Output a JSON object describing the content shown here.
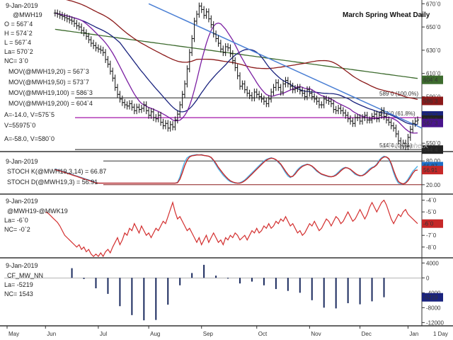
{
  "chart_data": [
    {
      "type": "candlestick",
      "title": "March Spring Wheat Daily",
      "header": {
        "date": "9-Jan-2019",
        "symbol": "@MWH19",
        "open": "O = 567`4",
        "high": "H = 574`2",
        "low": "L = 567`4",
        "last": "La= 570`2",
        "net_change": "NC= 3`0",
        "ma_20": "MOV(@MWH19,20) = 567`3",
        "ma_50": "MOV(@MWH19,50) = 573`7",
        "ma_100": "MOV(@MWH19,100) = 586`3",
        "ma_200": "MOV(@MWH19,200) = 604`4",
        "a_line": "A=-14.0, V=575`5",
        "volume": "V=55975`0",
        "a_line2": "A=-58.0, V=580`0"
      },
      "ylim": [
        544,
        672
      ],
      "y_ticks": [
        "670`0",
        "650`0",
        "630`0",
        "610`0",
        "590`0",
        "570`0",
        "550`0"
      ],
      "y_tick_values": [
        670,
        650,
        630,
        610,
        590,
        570,
        550
      ],
      "right_badges": [
        {
          "text": "604`4",
          "value": 604.5,
          "color": "#3d6b2e"
        },
        {
          "text": "586`3",
          "value": 586.4,
          "color": "#8b1a1a"
        },
        {
          "text": "573`7",
          "value": 573.9,
          "color": "#1a237e"
        },
        {
          "text": "570`2",
          "value": 570.25,
          "color": "#222222"
        },
        {
          "text": "567`3",
          "value": 567.4,
          "color": "#4a148c"
        },
        {
          "text": "544`4",
          "value": 544.5,
          "color": "#222222"
        }
      ],
      "fib_labels": [
        {
          "text": "589`0 (100.0%)",
          "value": 589.0
        },
        {
          "text": "572`0 (61.8%)",
          "value": 572.0
        },
        {
          "text": "544`4 (0.0%)",
          "value": 544.5
        }
      ],
      "watermark": "DTN ProphetX",
      "closes": [
        662,
        661,
        660,
        659,
        658,
        657,
        656,
        655,
        653,
        651,
        650,
        647,
        645,
        642,
        639,
        636,
        634,
        632,
        631,
        630,
        628,
        622,
        618,
        612,
        606,
        598,
        592,
        588,
        585,
        583,
        582,
        584,
        581,
        578,
        581,
        579,
        580,
        583,
        578,
        574,
        577,
        572,
        571,
        574,
        568,
        565,
        567,
        563,
        566,
        564,
        570,
        575,
        583,
        592,
        601,
        614,
        628,
        640,
        655,
        661,
        668,
        665,
        660,
        663,
        657,
        652,
        644,
        640,
        636,
        631,
        628,
        633,
        632,
        627,
        621,
        615,
        608,
        599,
        601,
        596,
        593,
        591,
        589,
        594,
        592,
        590,
        588,
        586,
        584,
        588,
        594,
        598,
        602,
        598,
        594,
        601,
        604,
        601,
        599,
        596,
        597,
        598,
        595,
        593,
        590,
        596,
        593,
        590,
        588,
        586,
        583,
        583,
        588,
        587,
        586,
        584,
        579,
        578,
        580,
        578,
        576,
        574,
        571,
        569,
        567,
        572,
        572,
        569,
        572,
        574,
        570,
        570,
        573,
        575,
        571,
        574,
        578,
        573,
        570,
        568,
        565,
        563,
        558,
        552,
        548,
        550,
        547,
        555,
        562,
        567,
        569,
        570
      ]
    },
    {
      "type": "line",
      "header": {
        "date": "9-Jan-2019",
        "stoch_k": "STOCH K(@MWH19,3,14) = 66.87",
        "stoch_d": "STOCH D(@MWH19,3) = 56.91"
      },
      "ylim": [
        0,
        100
      ],
      "y_ticks": [
        "80.00",
        "20.00"
      ],
      "y_tick_values": [
        80,
        20
      ],
      "right_badges": [
        {
          "text": "66.87",
          "value": 66.87,
          "color": "#1e6fc7"
        },
        {
          "text": "56.91",
          "value": 56.91,
          "color": "#c62828"
        }
      ],
      "series": [
        {
          "name": "STOCH K",
          "color": "#4fb3e8",
          "values": [
            60,
            58,
            56,
            54,
            52,
            50,
            48,
            46,
            44,
            42,
            40,
            38,
            36,
            34,
            32,
            30,
            28,
            26,
            24,
            24,
            24,
            24,
            24,
            24,
            24,
            24,
            24,
            24,
            24,
            24,
            24,
            24,
            24,
            24,
            24,
            24,
            24,
            24,
            24,
            24,
            24,
            24,
            24,
            24,
            24,
            24,
            24,
            24,
            24,
            24,
            24,
            26,
            40,
            60,
            78,
            88,
            92,
            94,
            95,
            96,
            95,
            96,
            94,
            93,
            92,
            88,
            80,
            70,
            60,
            52,
            44,
            38,
            32,
            28,
            26,
            24,
            24,
            25,
            28,
            32,
            38,
            44,
            50,
            56,
            62,
            68,
            74,
            80,
            84,
            86,
            88,
            86,
            82,
            76,
            70,
            60,
            50,
            42,
            38,
            42,
            50,
            58,
            64,
            68,
            70,
            72,
            70,
            66,
            60,
            54,
            50,
            46,
            44,
            42,
            40,
            40,
            42,
            46,
            52,
            58,
            62,
            64,
            62,
            58,
            52,
            46,
            44,
            42,
            44,
            48,
            54,
            60,
            64,
            66,
            72,
            82,
            88,
            92,
            90,
            84,
            70,
            50,
            34,
            24,
            22,
            22,
            26,
            34,
            44,
            54,
            60,
            66.87
          ]
        },
        {
          "name": "STOCH D",
          "color": "#c62828",
          "values": [
            58,
            57,
            55,
            53,
            51,
            49,
            47,
            45,
            43,
            41,
            39,
            37,
            35,
            33,
            31,
            29,
            27,
            25,
            24,
            24,
            24,
            24,
            24,
            24,
            24,
            24,
            24,
            24,
            24,
            24,
            24,
            24,
            24,
            24,
            24,
            24,
            24,
            24,
            24,
            24,
            24,
            24,
            24,
            24,
            24,
            24,
            24,
            24,
            24,
            24,
            24,
            25,
            34,
            50,
            68,
            82,
            90,
            93,
            94,
            95,
            95,
            95,
            94,
            93,
            92,
            89,
            82,
            74,
            64,
            56,
            48,
            41,
            35,
            30,
            27,
            25,
            24,
            24,
            26,
            30,
            35,
            41,
            47,
            53,
            59,
            65,
            71,
            77,
            82,
            85,
            87,
            86,
            83,
            78,
            72,
            63,
            54,
            46,
            40,
            41,
            47,
            55,
            61,
            66,
            69,
            71,
            70,
            67,
            62,
            56,
            51,
            47,
            45,
            43,
            41,
            40,
            41,
            44,
            49,
            55,
            60,
            63,
            62,
            59,
            54,
            49,
            45,
            43,
            43,
            46,
            51,
            57,
            62,
            65,
            70,
            79,
            86,
            90,
            90,
            86,
            74,
            56,
            40,
            28,
            24,
            22,
            24,
            30,
            39,
            49,
            56,
            56.91
          ]
        }
      ]
    },
    {
      "type": "line",
      "header": {
        "date": "9-Jan-2019",
        "symbol": "@MWH19-@MWK19",
        "last": "La= -6`0",
        "net_change": "NC= -0`2"
      },
      "ylim": [
        -8.8,
        -3.6
      ],
      "y_ticks": [
        "-4`0",
        "-5`0",
        "-6`0",
        "-7`0",
        "-8`0"
      ],
      "y_tick_values": [
        -4,
        -5,
        -6,
        -7,
        -8
      ],
      "right_badges": [
        {
          "text": "-6`0",
          "value": -6.0,
          "color": "#c62828"
        }
      ],
      "series": [
        {
          "name": "@MWH19-@MWK19",
          "color": "#d32f2f",
          "values": [
            -5.0,
            -5.1,
            -5.3,
            -5.5,
            -5.7,
            -5.9,
            -6.2,
            -6.6,
            -7.0,
            -7.2,
            -7.4,
            -7.6,
            -7.8,
            -8.0,
            -7.8,
            -8.2,
            -8.0,
            -8.4,
            -8.2,
            -8.6,
            -8.8,
            -8.6,
            -8.8,
            -8.5,
            -8.8,
            -8.4,
            -8.2,
            -8.5,
            -8.0,
            -7.6,
            -7.2,
            -7.8,
            -7.4,
            -6.8,
            -7.0,
            -6.4,
            -6.6,
            -6.0,
            -6.4,
            -6.8,
            -6.2,
            -6.6,
            -7.0,
            -6.8,
            -7.2,
            -6.8,
            -6.4,
            -6.6,
            -6.2,
            -5.8,
            -6.0,
            -5.4,
            -4.8,
            -4.2,
            -5.0,
            -5.6,
            -5.4,
            -5.8,
            -6.2,
            -6.6,
            -6.4,
            -6.8,
            -7.2,
            -7.6,
            -7.2,
            -7.8,
            -7.4,
            -7.0,
            -7.6,
            -7.2,
            -6.8,
            -7.2,
            -7.6,
            -7.4,
            -7.8,
            -7.2,
            -7.4,
            -7.0,
            -7.2,
            -6.8,
            -7.0,
            -7.4,
            -7.2,
            -7.0,
            -7.4,
            -7.0,
            -6.6,
            -6.8,
            -6.4,
            -6.8,
            -6.6,
            -6.2,
            -6.4,
            -6.0,
            -6.4,
            -6.2,
            -5.8,
            -6.0,
            -5.6,
            -5.8,
            -5.4,
            -5.8,
            -6.2,
            -6.0,
            -6.4,
            -6.8,
            -6.6,
            -7.0,
            -6.8,
            -6.4,
            -6.0,
            -6.2,
            -5.8,
            -6.2,
            -6.6,
            -6.4,
            -6.0,
            -5.6,
            -5.8,
            -6.2,
            -5.8,
            -5.4,
            -5.6,
            -6.0,
            -5.8,
            -5.4,
            -5.0,
            -5.4,
            -5.8,
            -5.6,
            -5.2,
            -4.8,
            -5.2,
            -5.6,
            -5.2,
            -4.6,
            -4.2,
            -4.6,
            -5.0,
            -4.6,
            -4.2,
            -4.0,
            -4.4,
            -5.0,
            -5.6,
            -6.0,
            -5.6,
            -5.2,
            -5.4,
            -5.0,
            -4.8,
            -5.2,
            -5.4,
            -5.6,
            -5.8,
            -6.0
          ]
        }
      ]
    },
    {
      "type": "bar",
      "header": {
        "date": "9-Jan-2019",
        "symbol": "CF_MW_NN",
        "last": "La= -5219",
        "net_change": "NC= 1543"
      },
      "ylim": [
        -12500,
        5000
      ],
      "y_ticks": [
        "4000",
        "0",
        "-4000",
        "-8000",
        "-12000"
      ],
      "y_tick_values": [
        4000,
        0,
        -4000,
        -8000,
        -12000
      ],
      "right_badges": [
        {
          "text": "-5219",
          "value": -5219,
          "color": "#1a237e"
        }
      ],
      "weekly_bars": [
        {
          "i": 8,
          "v": 2600
        },
        {
          "i": 13,
          "v": -300
        },
        {
          "i": 18,
          "v": -2800
        },
        {
          "i": 23,
          "v": -4300
        },
        {
          "i": 28,
          "v": -7600
        },
        {
          "i": 33,
          "v": -10000
        },
        {
          "i": 38,
          "v": -11400
        },
        {
          "i": 43,
          "v": -11300
        },
        {
          "i": 48,
          "v": -7200
        },
        {
          "i": 53,
          "v": -2000
        },
        {
          "i": 58,
          "v": 1300
        },
        {
          "i": 63,
          "v": 3500
        },
        {
          "i": 68,
          "v": 600
        },
        {
          "i": 73,
          "v": -200
        },
        {
          "i": 78,
          "v": -1500
        },
        {
          "i": 83,
          "v": -1000
        },
        {
          "i": 88,
          "v": -2000
        },
        {
          "i": 93,
          "v": -3000
        },
        {
          "i": 98,
          "v": -3500
        },
        {
          "i": 103,
          "v": -4000
        },
        {
          "i": 108,
          "v": -6000
        },
        {
          "i": 113,
          "v": -8000
        },
        {
          "i": 118,
          "v": -8200
        },
        {
          "i": 123,
          "v": -6800
        },
        {
          "i": 128,
          "v": -7100
        },
        {
          "i": 133,
          "v": -6300
        },
        {
          "i": 138,
          "v": -5200
        }
      ]
    }
  ],
  "x_axis": {
    "months": [
      "May",
      "Jun",
      "Jul",
      "Aug",
      "Sep",
      "Oct",
      "Nov",
      "Dec",
      "Jan"
    ],
    "month_index": [
      0,
      16,
      38,
      59,
      81,
      104,
      126,
      147,
      167
    ],
    "last_index": 171,
    "right_label": "1 Day"
  }
}
